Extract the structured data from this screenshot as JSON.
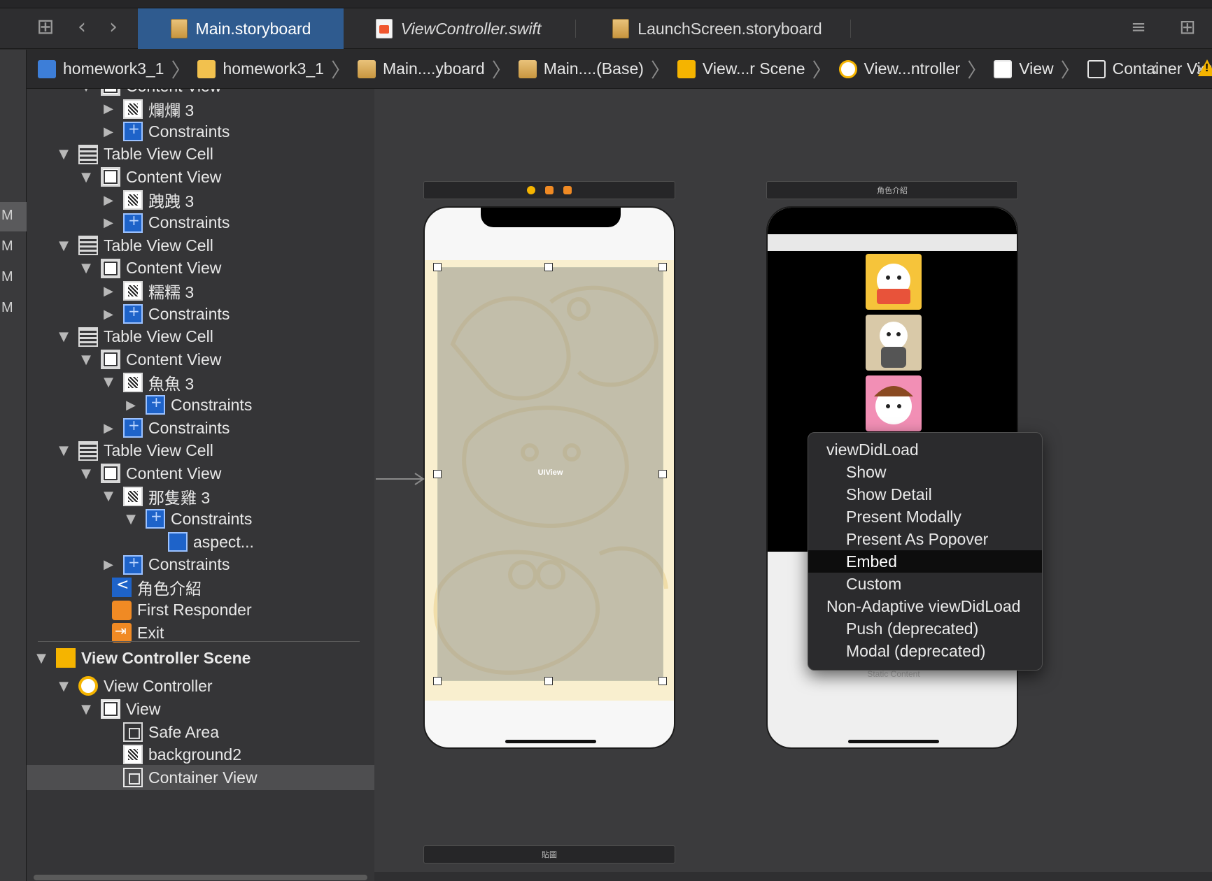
{
  "toolbar": {
    "tabs": [
      {
        "label": "Main.storyboard",
        "active": true
      },
      {
        "label": "ViewController.swift",
        "active": false
      },
      {
        "label": "LaunchScreen.storyboard",
        "active": false
      }
    ]
  },
  "breadcrumb": [
    {
      "label": "homework3_1",
      "icon": "project-icon"
    },
    {
      "label": "homework3_1",
      "icon": "folder-icon"
    },
    {
      "label": "Main....yboard",
      "icon": "storyboard-icon"
    },
    {
      "label": "Main....(Base)",
      "icon": "storyboard-icon"
    },
    {
      "label": "View...r Scene",
      "icon": "scene-icon"
    },
    {
      "label": "View...ntroller",
      "icon": "view-controller-icon"
    },
    {
      "label": "View",
      "icon": "view-icon"
    },
    {
      "label": "Container View",
      "icon": "container-view-icon"
    }
  ],
  "gutter_letters": [
    "M",
    "M",
    "M",
    "M"
  ],
  "outline": [
    {
      "label": "Content View",
      "depth": 2,
      "icon": "content",
      "tri": "down"
    },
    {
      "label": "爛爛 3",
      "depth": 3,
      "icon": "img",
      "tri": "right"
    },
    {
      "label": "Constraints",
      "depth": 3,
      "icon": "cons",
      "tri": "right"
    },
    {
      "label": "Table View Cell",
      "depth": 1,
      "icon": "cell",
      "tri": "down"
    },
    {
      "label": "Content View",
      "depth": 2,
      "icon": "content",
      "tri": "down"
    },
    {
      "label": "跩跩 3",
      "depth": 3,
      "icon": "img",
      "tri": "right"
    },
    {
      "label": "Constraints",
      "depth": 3,
      "icon": "cons",
      "tri": "right"
    },
    {
      "label": "Table View Cell",
      "depth": 1,
      "icon": "cell",
      "tri": "down"
    },
    {
      "label": "Content View",
      "depth": 2,
      "icon": "content",
      "tri": "down"
    },
    {
      "label": "糯糯 3",
      "depth": 3,
      "icon": "img",
      "tri": "right"
    },
    {
      "label": "Constraints",
      "depth": 3,
      "icon": "cons",
      "tri": "right"
    },
    {
      "label": "Table View Cell",
      "depth": 1,
      "icon": "cell",
      "tri": "down"
    },
    {
      "label": "Content View",
      "depth": 2,
      "icon": "content",
      "tri": "down"
    },
    {
      "label": "魚魚 3",
      "depth": 3,
      "icon": "img",
      "tri": "down"
    },
    {
      "label": "Constraints",
      "depth": 4,
      "icon": "cons",
      "tri": "right"
    },
    {
      "label": "Constraints",
      "depth": 3,
      "icon": "cons",
      "tri": "right"
    },
    {
      "label": "Table View Cell",
      "depth": 1,
      "icon": "cell",
      "tri": "down"
    },
    {
      "label": "Content View",
      "depth": 2,
      "icon": "content",
      "tri": "down"
    },
    {
      "label": "那隻雞 3",
      "depth": 3,
      "icon": "img",
      "tri": "down"
    },
    {
      "label": "Constraints",
      "depth": 4,
      "icon": "cons",
      "tri": "down"
    },
    {
      "label": "aspect...",
      "depth": 5,
      "icon": "aspect",
      "tri": "none"
    },
    {
      "label": "Constraints",
      "depth": 3,
      "icon": "cons",
      "tri": "right"
    },
    {
      "label": "角色介紹",
      "depth": 0,
      "icon": "nav",
      "tri": "none"
    },
    {
      "label": "First Responder",
      "depth": 0,
      "icon": "fr",
      "tri": "none"
    },
    {
      "label": "Exit",
      "depth": 0,
      "icon": "exit",
      "tri": "none"
    }
  ],
  "outline_scene": [
    {
      "label": "View Controller Scene",
      "depth": 0,
      "icon": "scene",
      "tri": "down",
      "bold": true
    },
    {
      "label": "View Controller",
      "depth": 1,
      "icon": "vc",
      "tri": "down"
    },
    {
      "label": "View",
      "depth": 2,
      "icon": "view",
      "tri": "down"
    },
    {
      "label": "Safe Area",
      "depth": 3,
      "icon": "safe",
      "tri": "none"
    },
    {
      "label": "background2",
      "depth": 3,
      "icon": "img",
      "tri": "none"
    },
    {
      "label": "Container View",
      "depth": 3,
      "icon": "cv",
      "tri": "none",
      "selected": true
    }
  ],
  "canvas": {
    "right_scene_title": "角色介紹",
    "uiview_label": "UIView",
    "bottom_scene_title": "貼圖",
    "static_content_label": "Static Content"
  },
  "segue_menu": {
    "items": [
      {
        "label": "viewDidLoad",
        "sub": false
      },
      {
        "label": "Show",
        "sub": true
      },
      {
        "label": "Show Detail",
        "sub": true
      },
      {
        "label": "Present Modally",
        "sub": true
      },
      {
        "label": "Present As Popover",
        "sub": true
      },
      {
        "label": "Embed",
        "sub": true,
        "highlight": true
      },
      {
        "label": "Custom",
        "sub": true
      },
      {
        "label": "Non-Adaptive viewDidLoad",
        "sub": false
      },
      {
        "label": "Push (deprecated)",
        "sub": true
      },
      {
        "label": "Modal (deprecated)",
        "sub": true
      }
    ]
  },
  "colors": {
    "active_tab": "#2f5b8f",
    "constraint_blue": "#1e63c9",
    "scene_yellow": "#f5b400",
    "menu_highlight": "#0d0d0d"
  }
}
